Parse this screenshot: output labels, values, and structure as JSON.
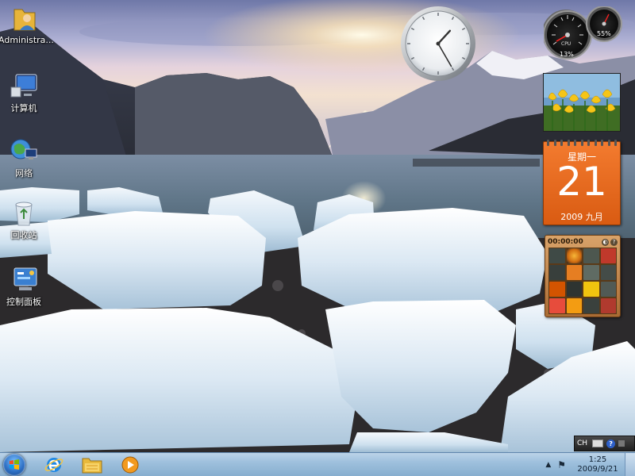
{
  "desktop_icons": [
    {
      "name": "administrator",
      "label": "Administra...",
      "icon": "user-folder-icon"
    },
    {
      "name": "computer",
      "label": "计算机",
      "icon": "computer-icon"
    },
    {
      "name": "network",
      "label": "网络",
      "icon": "network-icon"
    },
    {
      "name": "recycle-bin",
      "label": "回收站",
      "icon": "recycle-bin-icon"
    },
    {
      "name": "control-panel",
      "label": "控制面板",
      "icon": "control-panel-icon"
    }
  ],
  "gadgets": {
    "clock": {
      "hour": 1,
      "minute": 25
    },
    "cpu_meter": {
      "cpu_percent": "13%",
      "memory_percent": "55%",
      "cpu_label": "CPU"
    },
    "slideshow": {
      "subject": "tulips"
    },
    "calendar": {
      "weekday": "星期一",
      "day": "21",
      "month_year": "2009 九月"
    },
    "picture_puzzle": {
      "timer": "00:00:00"
    }
  },
  "langbar": {
    "language": "CH",
    "help": "?"
  },
  "taskbar": {
    "pinned": [
      {
        "name": "internet-explorer",
        "icon": "internet-explorer-icon"
      },
      {
        "name": "windows-explorer",
        "icon": "folder-icon"
      },
      {
        "name": "media-player",
        "icon": "media-player-icon"
      }
    ],
    "tray": {
      "time": "1:25",
      "date": "2009/9/21",
      "arrow": "▲",
      "flag": "⚑"
    }
  },
  "colors": {
    "calendar": "#e8661c",
    "taskbar": "#9ec0dd",
    "start_orb": "#2d6fc4"
  }
}
